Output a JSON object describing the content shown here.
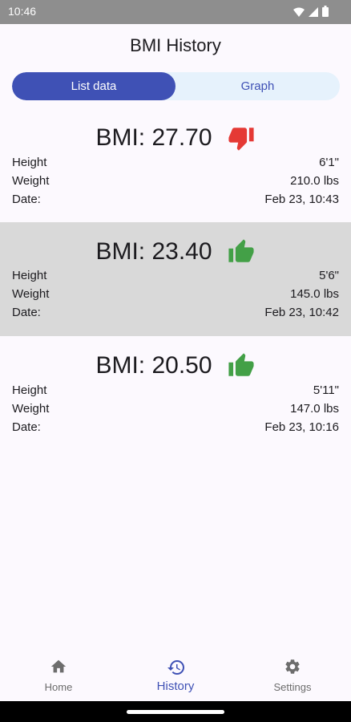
{
  "status_bar": {
    "time": "10:46"
  },
  "header": {
    "title": "BMI History"
  },
  "tabs": [
    {
      "label": "List data",
      "active": true
    },
    {
      "label": "Graph",
      "active": false
    }
  ],
  "entries": [
    {
      "bmi": "BMI: 27.70",
      "rating": "thumbs-down",
      "rating_color": "#e53935",
      "height_label": "Height",
      "height": "6'1\"",
      "weight_label": "Weight",
      "weight": "210.0 lbs",
      "date_label": "Date:",
      "date": "Feb 23, 10:43"
    },
    {
      "bmi": "BMI: 23.40",
      "rating": "thumbs-up",
      "rating_color": "#43a047",
      "height_label": "Height",
      "height": "5'6\"",
      "weight_label": "Weight",
      "weight": "145.0 lbs",
      "date_label": "Date:",
      "date": "Feb 23, 10:42"
    },
    {
      "bmi": "BMI: 20.50",
      "rating": "thumbs-up",
      "rating_color": "#43a047",
      "height_label": "Height",
      "height": "5'11\"",
      "weight_label": "Weight",
      "weight": "147.0 lbs",
      "date_label": "Date:",
      "date": "Feb 23, 10:16"
    }
  ],
  "bottom_nav": [
    {
      "label": "Home",
      "icon": "home-icon",
      "active": false
    },
    {
      "label": "History",
      "icon": "history-icon",
      "active": true
    },
    {
      "label": "Settings",
      "icon": "gear-icon",
      "active": false
    }
  ],
  "colors": {
    "accent": "#3f51b5",
    "tab_bg": "#e6f2fc",
    "shaded_row": "#d9d9d9"
  }
}
